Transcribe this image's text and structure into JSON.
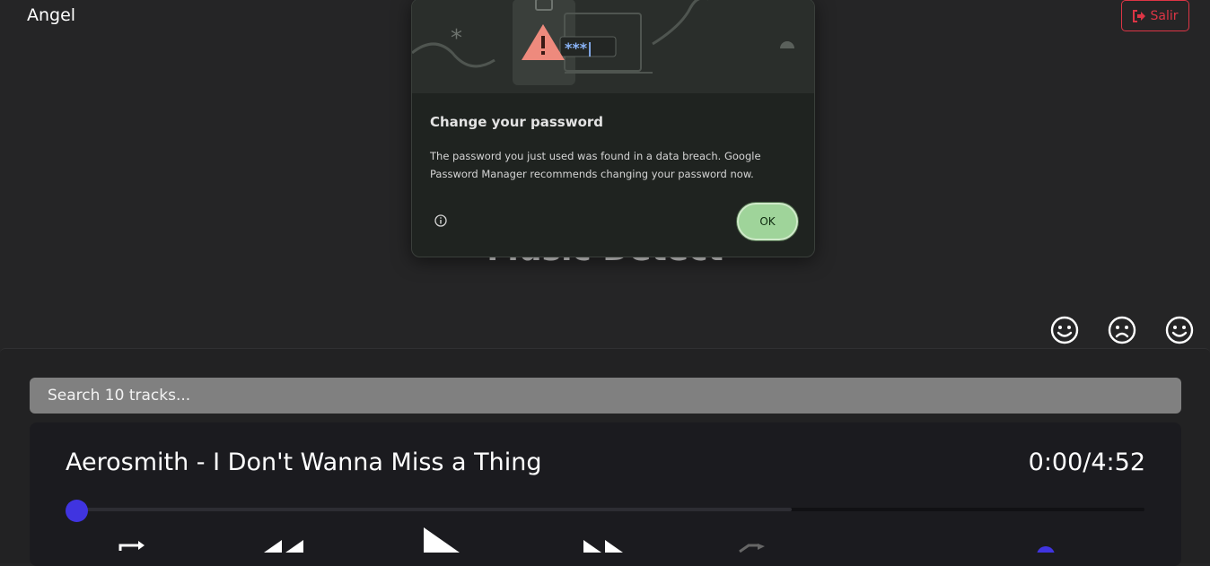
{
  "header": {
    "username": "Angel",
    "logout_label": "Salir"
  },
  "page": {
    "title": "Music Detect"
  },
  "moods": [
    {
      "icon": "smile-icon"
    },
    {
      "icon": "frown-icon"
    },
    {
      "icon": "smile-icon"
    }
  ],
  "search": {
    "placeholder": "Search 10 tracks..."
  },
  "player": {
    "track_title": "Aerosmith - I Don't Wanna Miss a Thing",
    "time_display": "0:00/4:52",
    "progress_fraction": 0.0,
    "buffer_fraction": 0.67,
    "accent_color": "#4034e0"
  },
  "dialog": {
    "title": "Change your password",
    "body": "The password you just used was found in a data breach. Google Password Manager recommends changing your password now.",
    "ok_label": "OK",
    "art_masked_text": "***|"
  }
}
